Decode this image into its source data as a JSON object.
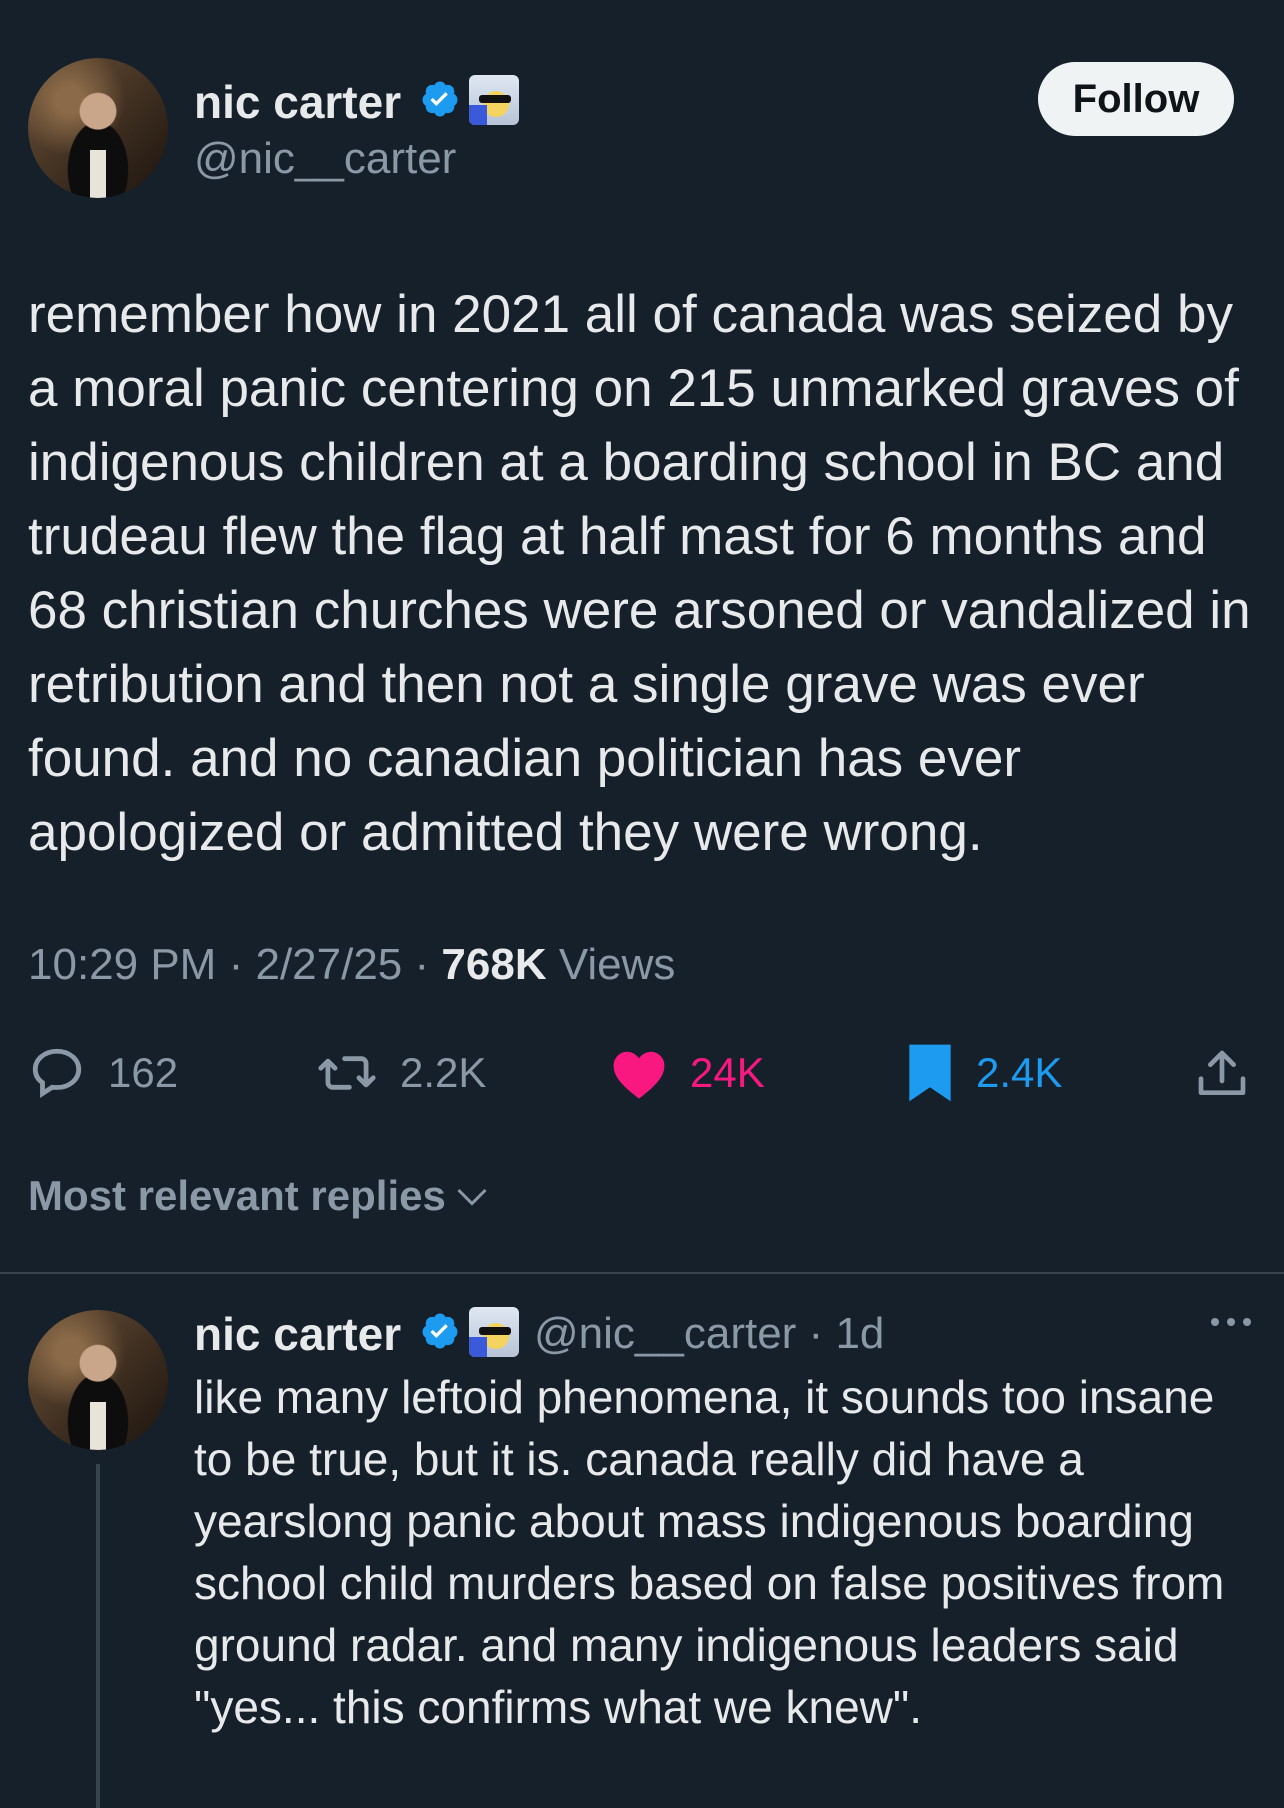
{
  "tweet": {
    "author_name": "nic carter",
    "author_handle": "@nic__carter",
    "follow_label": "Follow",
    "text": "remember how in 2021 all of canada was seized by a moral panic centering on 215 unmarked graves of indigenous children at a boarding school in BC and trudeau flew the flag at half mast for 6 months and 68 christian churches were arsoned or vandalized in retribution and then not a single grave was ever found. and no canadian politician has ever apologized or admitted they were wrong.",
    "time": "10:29 PM",
    "date": "2/27/25",
    "views_count": "768K",
    "views_label": "Views",
    "replies": "162",
    "reposts": "2.2K",
    "likes": "24K",
    "bookmarks": "2.4K"
  },
  "sort_label": "Most relevant replies",
  "reply": {
    "author_name": "nic carter",
    "author_handle": "@nic__carter",
    "age": "1d",
    "text": "like many leftoid phenomena, it sounds too insane to be true, but it is. canada really did have a yearslong panic about mass indigenous boarding school child murders based on false positives from ground radar. and many indigenous leaders said \"yes... this confirms what we knew\"."
  },
  "icons": {
    "verified": "verified-badge-icon",
    "custom_badge": "sunglasses-emoji-icon",
    "reply": "speech-bubble-icon",
    "repost": "repost-arrows-icon",
    "like": "heart-icon",
    "bookmark": "bookmark-icon",
    "share": "share-upload-icon",
    "chevron": "chevron-down-icon",
    "more": "more-dots-icon"
  },
  "colors": {
    "background": "#15202b",
    "text": "#e7e9ea",
    "muted": "#8b98a5",
    "like": "#f91880",
    "bookmark": "#1d9bf0",
    "verified": "#1d9bf0"
  }
}
